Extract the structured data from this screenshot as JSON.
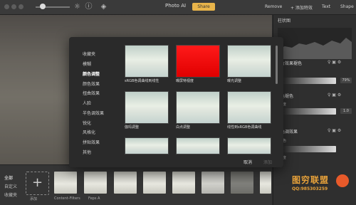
{
  "titlebar": {
    "app_title": "Photo AI",
    "share_label": "Share",
    "remove_label": "Remove",
    "add_effect_label": "+ 添加特效",
    "text_label": "Text",
    "shape_label": "Shape"
  },
  "right_panel": {
    "title": "柱状图",
    "sections": [
      {
        "title": "片效果褪色",
        "sub": "",
        "value": "",
        "val2": "79%"
      },
      {
        "title": "色褪色",
        "sub": "强度",
        "value": ""
      },
      {
        "title": "色调效果",
        "sub": "颜色",
        "value": ""
      },
      {
        "title": "",
        "sub": "强度",
        "value": ""
      }
    ]
  },
  "bottom": {
    "categories": [
      "全部",
      "自定义",
      "收藏夹"
    ],
    "add_label": "添加",
    "thumbs": [
      "Content-Filters",
      "Feps A",
      "",
      "",
      "",
      "",
      "",
      ""
    ]
  },
  "modal": {
    "categories": [
      "收藏夹",
      "模糊",
      "颜色调整",
      "颜色效果",
      "扭曲效果",
      "人脸",
      "半色调效果",
      "锐化",
      "风格化",
      "拼贴效果",
      "其他"
    ],
    "active_category": "颜色调整",
    "effects": [
      {
        "label": "sRGB色调曲线到线性",
        "style": "photo"
      },
      {
        "label": "曝屏特视度",
        "style": "red"
      },
      {
        "label": "曝光调整",
        "style": "photo"
      },
      {
        "label": "伽玛调整",
        "style": "photo"
      },
      {
        "label": "白点调整",
        "style": "photo"
      },
      {
        "label": "线性到sRGB色调曲线",
        "style": "photo"
      },
      {
        "label": "",
        "style": "photo"
      },
      {
        "label": "",
        "style": "photo"
      },
      {
        "label": "",
        "style": "photo"
      }
    ],
    "cancel_label": "取消",
    "ok_label": "添加"
  },
  "watermark": {
    "title": "图穷联盟",
    "qq": "QQ:985303259"
  }
}
